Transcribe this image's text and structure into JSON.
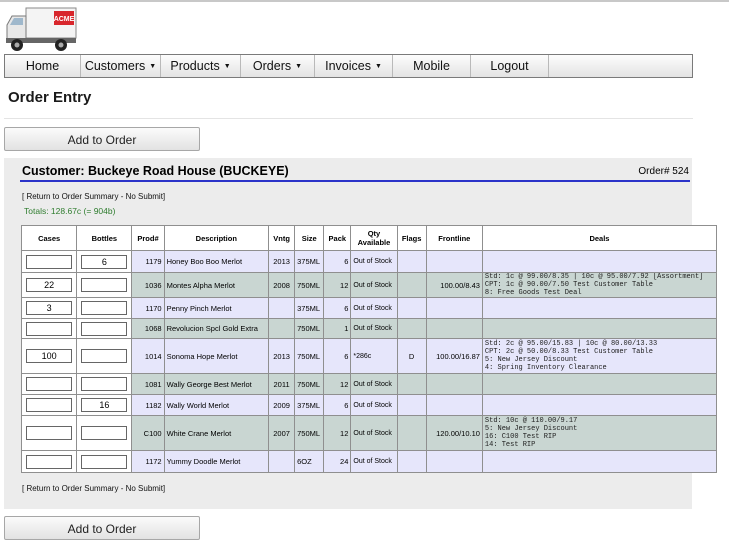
{
  "logo": {
    "truck_text": "ACME"
  },
  "nav": [
    {
      "label": "Home",
      "dropdown": false
    },
    {
      "label": "Customers",
      "dropdown": true
    },
    {
      "label": "Products",
      "dropdown": true
    },
    {
      "label": "Orders",
      "dropdown": true
    },
    {
      "label": "Invoices",
      "dropdown": true
    },
    {
      "label": "Mobile",
      "dropdown": false
    },
    {
      "label": "Logout",
      "dropdown": false
    }
  ],
  "page_title": "Order Entry",
  "add_button": "Add to Order",
  "customer_title": "Customer: Buckeye Road House (BUCKEYE)",
  "order_number": "Order# 524",
  "return_link": "[ Return to Order Summary - No Submit]",
  "totals": "Totals: 128.67c (= 904b)",
  "columns": [
    "Cases",
    "Bottles",
    "Prod#",
    "Description",
    "Vntg",
    "Size",
    "Pack",
    "Qty Available",
    "Flags",
    "Frontline",
    "Deals"
  ],
  "rows": [
    {
      "cases": "",
      "bottles": "6",
      "prod": "1179",
      "desc": "Honey Boo Boo Merlot",
      "vntg": "2013",
      "size": "375ML",
      "pack": "6",
      "qty": "Out of Stock",
      "flags": "",
      "frontline": "",
      "deals": ""
    },
    {
      "cases": "22",
      "bottles": "",
      "prod": "1036",
      "desc": "Montes Alpha Merlot",
      "vntg": "2008",
      "size": "750ML",
      "pack": "12",
      "qty": "Out of Stock",
      "flags": "",
      "frontline": "100.00/8.43",
      "deals": "Std: 1c @ 99.00/8.35 | 10c @ 95.00/7.92 [Assortment]\nCPT: 1c @ 90.00/7.50 Test Customer Table\n8: Free Goods Test Deal"
    },
    {
      "cases": "3",
      "bottles": "",
      "prod": "1170",
      "desc": "Penny Pinch Merlot",
      "vntg": "",
      "size": "375ML",
      "pack": "6",
      "qty": "Out of Stock",
      "flags": "",
      "frontline": "",
      "deals": ""
    },
    {
      "cases": "",
      "bottles": "",
      "prod": "1068",
      "desc": "Revolucion Spcl Gold Extra",
      "vntg": "",
      "size": "750ML",
      "pack": "1",
      "qty": "Out of Stock",
      "flags": "",
      "frontline": "",
      "deals": ""
    },
    {
      "cases": "100",
      "bottles": "",
      "prod": "1014",
      "desc": "Sonoma Hope Merlot",
      "vntg": "2013",
      "size": "750ML",
      "pack": "6",
      "qty": "*286c",
      "flags": "D",
      "frontline": "100.00/16.87",
      "deals": "Std: 2c @ 95.00/15.83 | 10c @ 80.00/13.33\nCPT: 2c @ 50.00/8.33 Test Customer Table\n5: New Jersey Discount\n4: Spring Inventory Clearance"
    },
    {
      "cases": "",
      "bottles": "",
      "prod": "1081",
      "desc": "Wally George Best Merlot",
      "vntg": "2011",
      "size": "750ML",
      "pack": "12",
      "qty": "Out of Stock",
      "flags": "",
      "frontline": "",
      "deals": ""
    },
    {
      "cases": "",
      "bottles": "16",
      "prod": "1182",
      "desc": "Wally World Merlot",
      "vntg": "2009",
      "size": "375ML",
      "pack": "6",
      "qty": "Out of Stock",
      "flags": "",
      "frontline": "",
      "deals": ""
    },
    {
      "cases": "",
      "bottles": "",
      "prod": "C100",
      "desc": "White Crane Merlot",
      "vntg": "2007",
      "size": "750ML",
      "pack": "12",
      "qty": "Out of Stock",
      "flags": "",
      "frontline": "120.00/10.10",
      "deals": "Std: 10c @ 110.00/9.17\n5: New Jersey Discount\n16: C100 Test RIP\n14: Test RIP"
    },
    {
      "cases": "",
      "bottles": "",
      "prod": "1172",
      "desc": "Yummy Doodle Merlot",
      "vntg": "",
      "size": "6OZ",
      "pack": "24",
      "qty": "Out of Stock",
      "flags": "",
      "frontline": "",
      "deals": ""
    }
  ]
}
